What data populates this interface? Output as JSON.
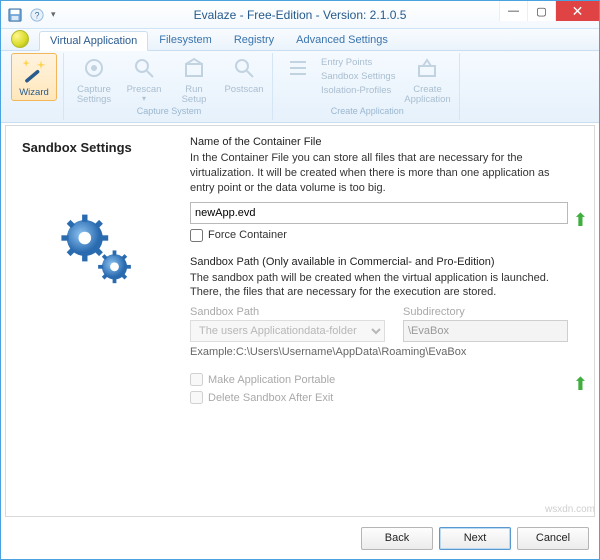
{
  "title": "Evalaze - Free-Edition - Version: 2.1.0.5",
  "tabs": {
    "virtual_application": "Virtual Application",
    "filesystem": "Filesystem",
    "registry": "Registry",
    "advanced_settings": "Advanced Settings"
  },
  "ribbon": {
    "wizard": "Wizard",
    "capture_settings": "Capture\nSettings",
    "prescan": "Prescan",
    "run_setup": "Run\nSetup",
    "postscan": "Postscan",
    "group_capture": "Capture System",
    "entry_points": "Entry Points",
    "sandbox_settings": "Sandbox Settings",
    "isolation_profiles": "Isolation-Profiles",
    "group_create": "Create Application",
    "create_application": "Create\nApplication"
  },
  "page": {
    "heading": "Sandbox Settings",
    "container_title": "Name of the Container File",
    "container_desc": "In the Container File you can store all files that are necessary for the virtualization. It will be created when there is more than one application as entry point or the data volume is too big.",
    "container_value": "newApp.evd",
    "force_container": "Force Container",
    "sandbox_title": "Sandbox Path (Only available in Commercial- and Pro-Edition)",
    "sandbox_desc": "The sandbox path will be created when the virtual application is launched. There, the files that are necessary for the execution are stored.",
    "sandbox_path_label": "Sandbox Path",
    "sandbox_path_value": "The users Applicationdata-folder",
    "subdirectory_label": "Subdirectory",
    "subdirectory_value": "\\EvaBox",
    "example": "Example:C:\\Users\\Username\\AppData\\Roaming\\EvaBox",
    "make_portable": "Make Application Portable",
    "delete_after_exit": "Delete Sandbox After Exit"
  },
  "footer": {
    "back": "Back",
    "next": "Next",
    "cancel": "Cancel"
  },
  "watermark": "wsxdn.com"
}
